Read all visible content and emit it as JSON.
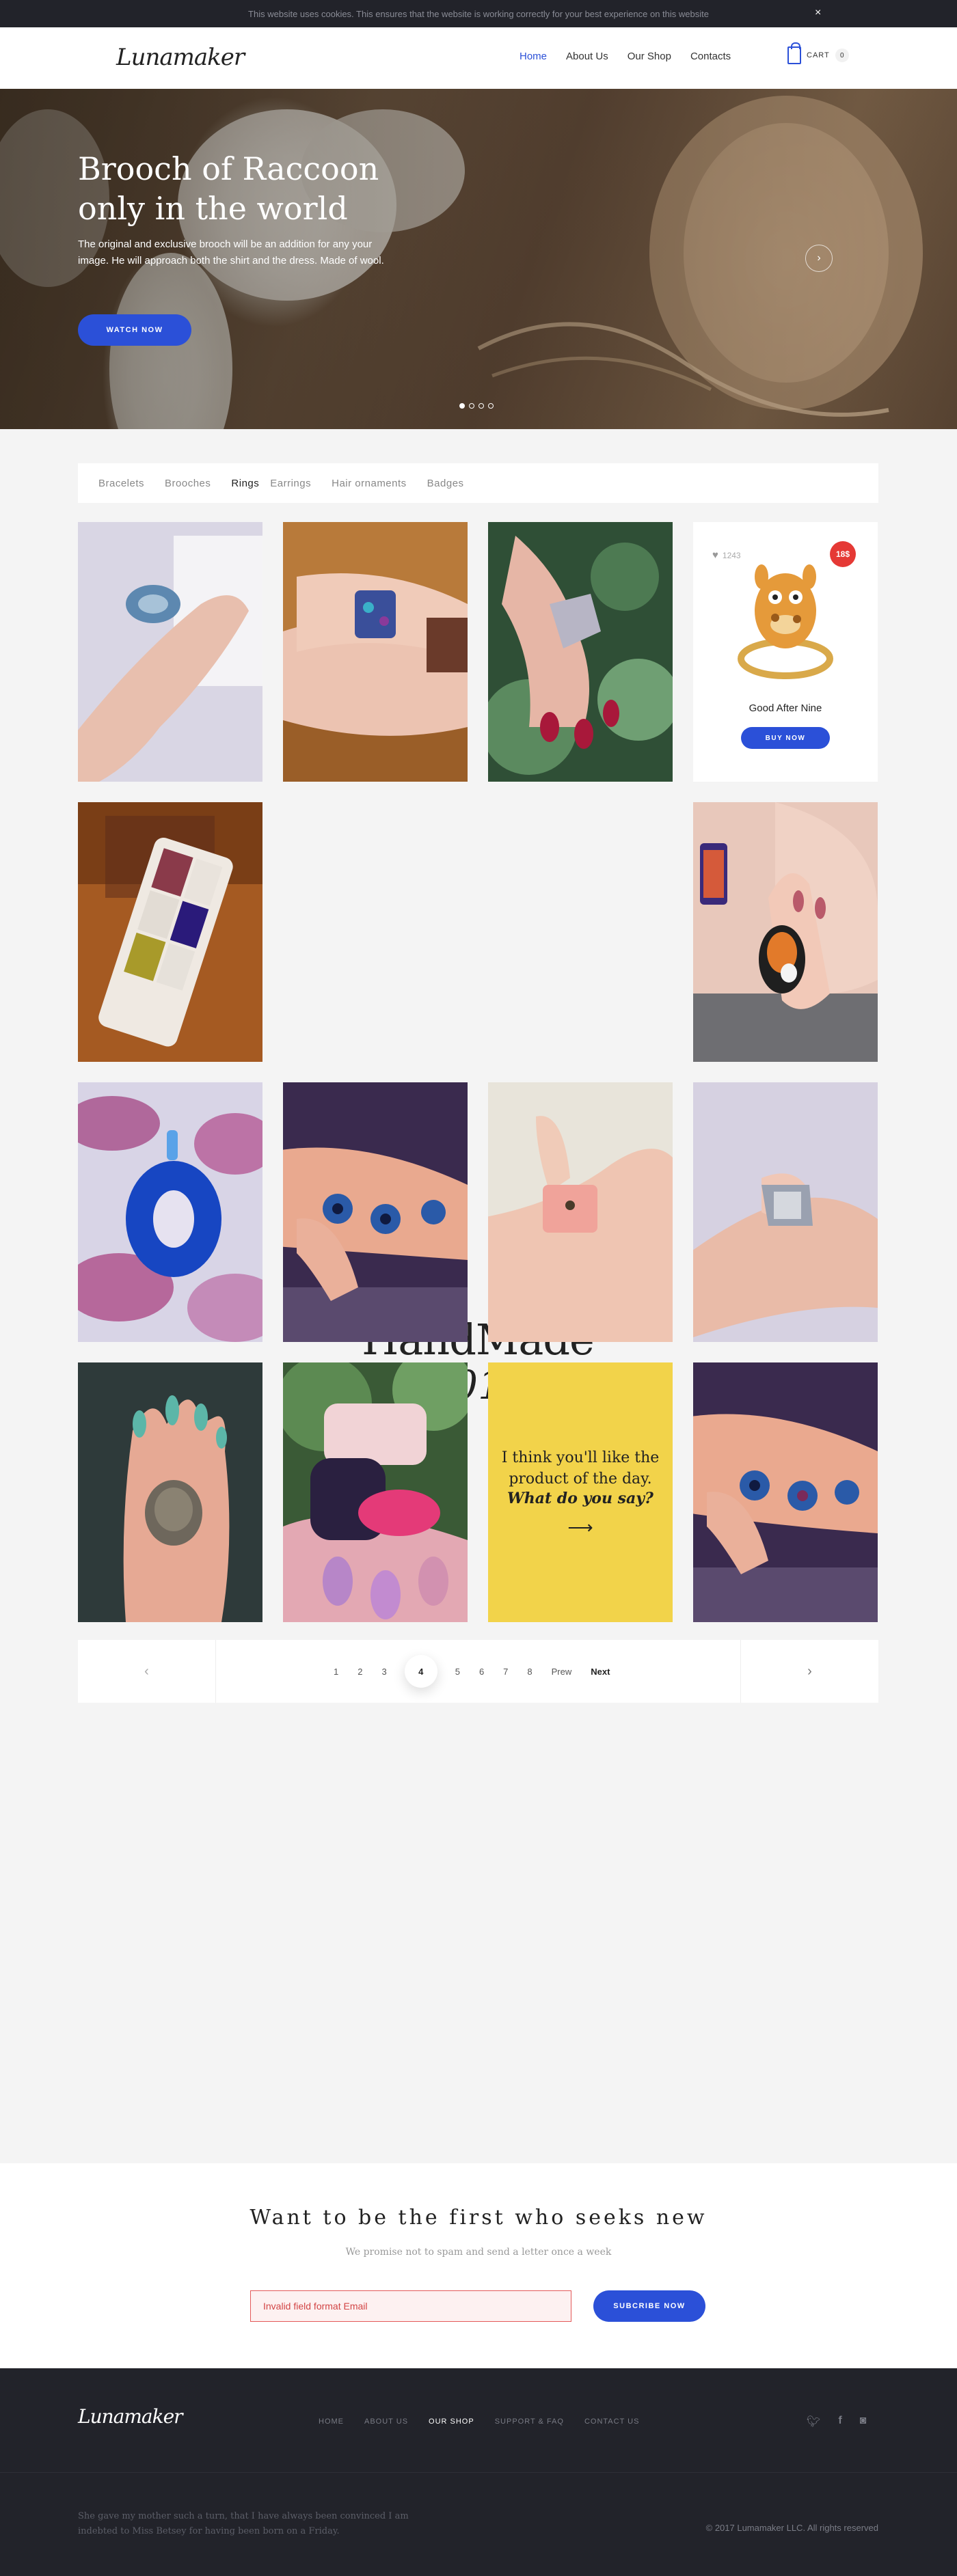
{
  "cookie": {
    "text": "This website uses cookies. This ensures that the website is working correctly for your best experience on this website",
    "close": "×"
  },
  "header": {
    "logo": "Lunamaker",
    "nav": [
      "Home",
      "About Us",
      "Our Shop",
      "Contacts"
    ],
    "active_nav": "Home",
    "cart_label": "CART",
    "cart_count": "0"
  },
  "hero": {
    "title_line1": "Brooch of Raccoon",
    "title_line2": "only in the world",
    "description": "The original and exclusive brooch will be an addition for any your image. He will approach both the shirt and the dress. Made of wool.",
    "cta": "WATCH NOW",
    "next_icon": "›",
    "slides": 4,
    "active_slide": 1
  },
  "categories": [
    "Bracelets",
    "Brooches",
    "Rings",
    "Earrings",
    "Hair ornaments",
    "Badges"
  ],
  "active_category": "Rings",
  "product_card": {
    "likes": "1243",
    "price": "18$",
    "name": "Good After Nine",
    "cta": "BUY NOW"
  },
  "handmade": {
    "line1": "HandMade",
    "line2": "2017"
  },
  "promo": {
    "line1": "I think you'll like the",
    "line2": "product of the day.",
    "line3": "What do you say?",
    "arrow": "⟶"
  },
  "pagination": {
    "pages": [
      "1",
      "2",
      "3",
      "4",
      "5",
      "6",
      "7",
      "8"
    ],
    "current": "4",
    "prev_label": "Prew",
    "next_label": "Next"
  },
  "newsletter": {
    "title": "Want to be the first who seeks new",
    "subtitle": "We promise not to spam and send a letter once a week",
    "field_value": "Invalid field format Email",
    "cta": "SUBCRIBE NOW"
  },
  "footer": {
    "logo": "Lunamaker",
    "nav": [
      "HOME",
      "ABOUT US",
      "OUR SHOP",
      "SUPPORT & FAQ",
      "CONTACT US"
    ],
    "active_nav": "OUR SHOP",
    "social_icons": [
      "twitter-icon",
      "facebook-icon",
      "instagram-icon"
    ],
    "quote": "She gave my mother such a turn, that I have always been convinced I am indebted to Miss Betsey for having been born on a Friday.",
    "copyright": "© 2017 Lumamaker LLC. All rights reserved"
  },
  "colors": {
    "accent": "#2b50d8",
    "dark": "#22232a",
    "sale": "#e53935",
    "promo": "#f2d34a"
  }
}
